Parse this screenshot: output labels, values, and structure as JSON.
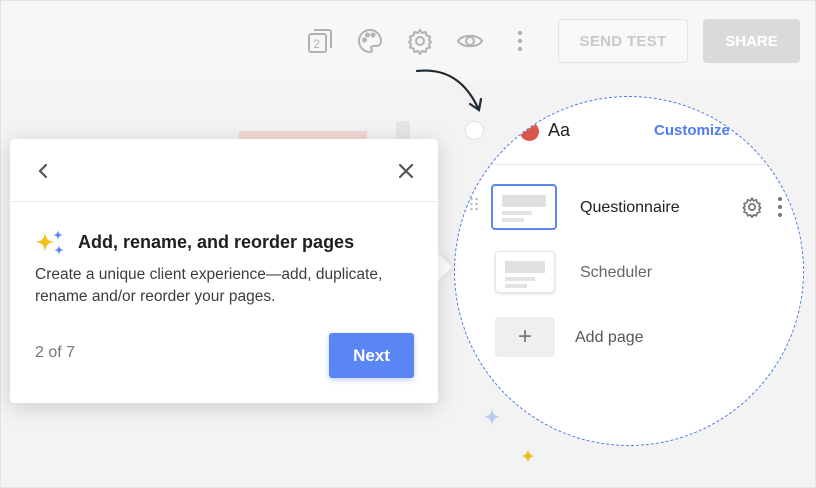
{
  "toolbar": {
    "page_count_badge": "2",
    "send_test_label": "SEND TEST",
    "share_label": "SHARE"
  },
  "theme": {
    "font_preview": "Aa",
    "customize_label": "Customize theme",
    "swatch_colors": [
      "#ffffff",
      "#c8c8c8",
      "#d8574a"
    ]
  },
  "pages": [
    {
      "name": "Questionnaire",
      "active": true
    },
    {
      "name": "Scheduler",
      "active": false
    }
  ],
  "add_page_label": "Add page",
  "tooltip": {
    "title": "Add, rename, and reorder pages",
    "body": "Create a unique client experience—add, duplicate, rename and/or reorder your pages.",
    "step": "2 of 7",
    "next_label": "Next"
  },
  "colors": {
    "accent": "#5a86f5",
    "link": "#4f7cf2",
    "spotlight_border": "#4a7be0"
  },
  "icons": [
    "page-count-icon",
    "palette-icon",
    "gear-icon",
    "eye-icon",
    "more-vertical-icon",
    "chevron-left-icon",
    "close-icon",
    "sparkle-icon",
    "drag-handle-icon",
    "plus-icon",
    "curved-arrow-icon"
  ]
}
